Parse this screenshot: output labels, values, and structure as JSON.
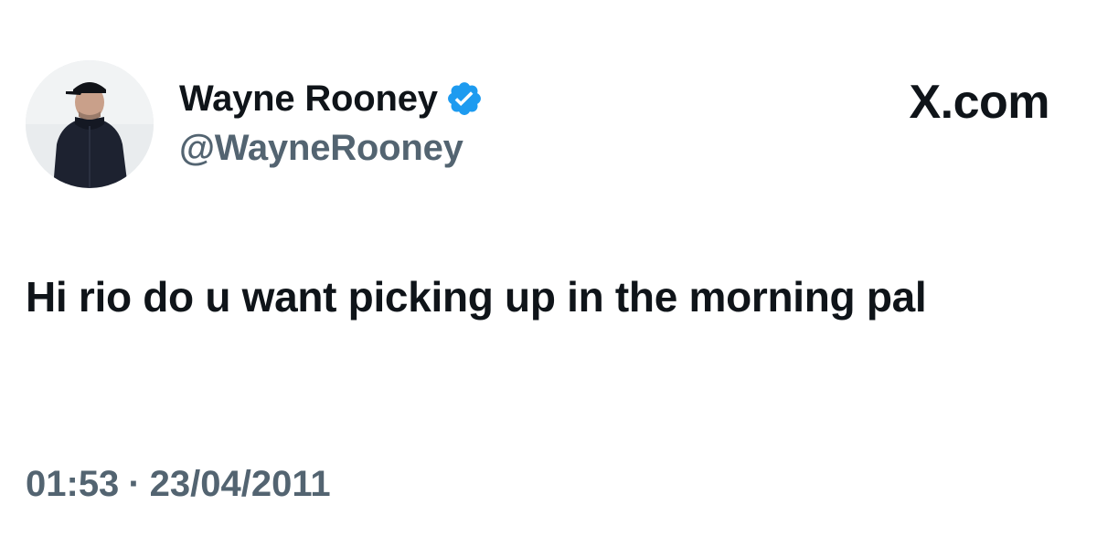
{
  "author": {
    "display_name": "Wayne Rooney",
    "handle": "@WayneRooney",
    "verified_icon": "verified-badge-icon",
    "avatar_icon": "profile-photo"
  },
  "brand": {
    "label": "X.com"
  },
  "tweet": {
    "text": "Hi rio do u want picking up in the morning pal",
    "time": "01:53",
    "separator": "·",
    "date": "23/04/2011"
  },
  "colors": {
    "text_primary": "#0f1419",
    "text_secondary": "#536471",
    "verified_blue": "#1d9bf0",
    "background": "#ffffff"
  }
}
